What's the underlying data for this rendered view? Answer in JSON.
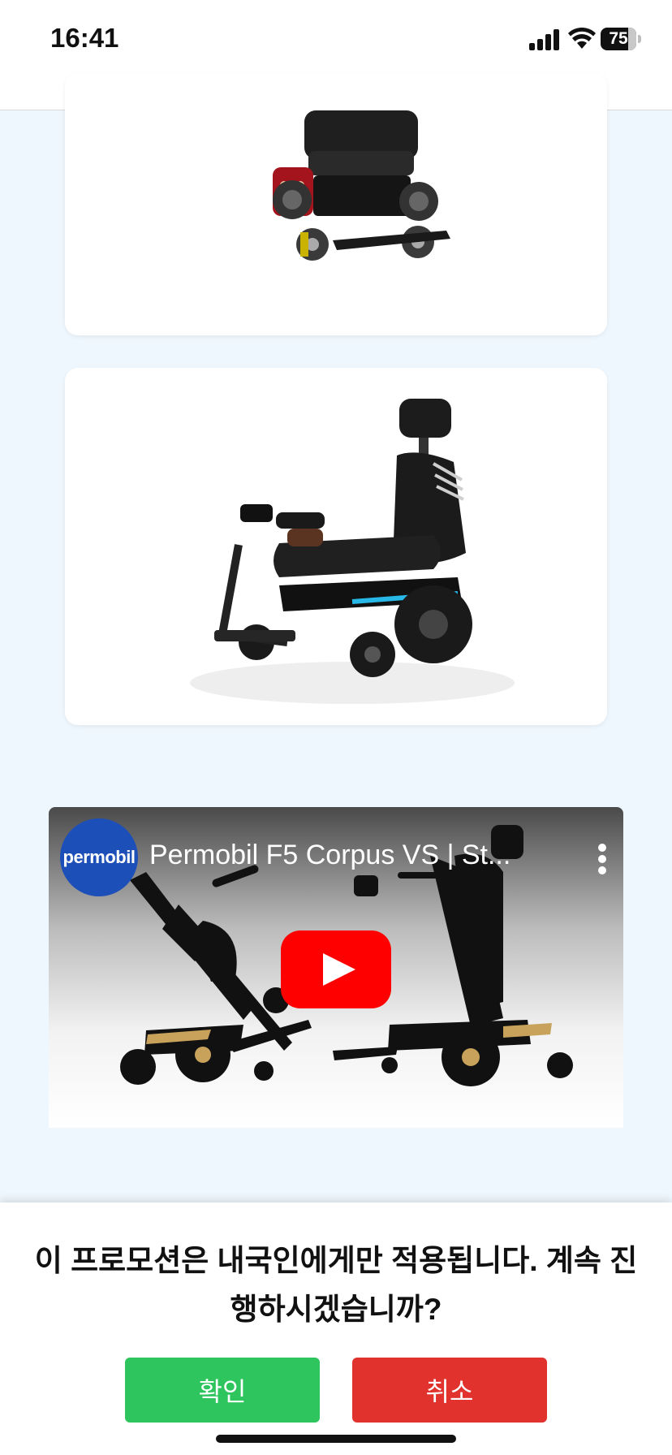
{
  "status_bar": {
    "time": "16:41",
    "battery_level": "75",
    "icons": [
      "signal-icon",
      "wifi-icon",
      "battery-icon"
    ]
  },
  "products": [
    {
      "image": "power-wheelchair-red-icon"
    },
    {
      "image": "power-wheelchair-black-icon"
    }
  ],
  "video": {
    "channel_avatar_text": "permobil",
    "title": "Permobil F5 Corpus VS | St...",
    "icons": [
      "more-options-icon",
      "youtube-play-icon"
    ],
    "play_color": "#ff0000"
  },
  "dialog": {
    "message": "이 프로모션은 내국인에게만 적용됩니다. 계속 진행하시겠습니까?",
    "confirm_label": "확인",
    "cancel_label": "취소",
    "confirm_color": "#2ec55e",
    "cancel_color": "#e1322e"
  }
}
